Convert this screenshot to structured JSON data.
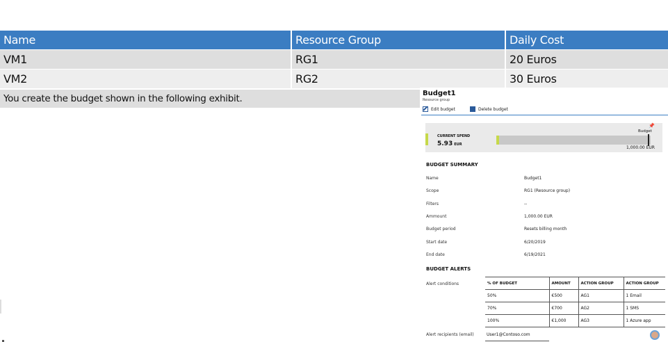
{
  "vm_table": {
    "headers": [
      "Name",
      "Resource Group",
      "Daily Cost"
    ],
    "rows": [
      [
        "VM1",
        "RG1",
        "20 Euros"
      ],
      [
        "VM2",
        "RG2",
        "30 Euros"
      ]
    ]
  },
  "exhibit_text": "You create the budget shown in the following exhibit.",
  "budget_panel": {
    "title": "Budget1",
    "subtitle": "Resource group",
    "toolbar": {
      "edit_label": "Edit budget",
      "delete_label": "Delete budget"
    },
    "current_spend": {
      "label": "CURRENT SPEND",
      "value": "5.93",
      "unit": "EUR",
      "budget_label": "Budget",
      "budget_max": "1,000.00 EUR",
      "fraction_of_budget": 0.00593
    },
    "summary": {
      "heading": "BUDGET SUMMARY",
      "items": [
        {
          "label": "Name",
          "value": "Budget1"
        },
        {
          "label": "Scope",
          "value": "RG1 (Resource group)"
        },
        {
          "label": "Filters",
          "value": "--"
        },
        {
          "label": "Ammount",
          "value": "1,000.00 EUR"
        },
        {
          "label": "Budget period",
          "value": "Resets billing month"
        },
        {
          "label": "Start date",
          "value": "6/20/2019"
        },
        {
          "label": "End date",
          "value": "6/19/2021"
        }
      ]
    },
    "alerts": {
      "heading": "BUDGET ALERTS",
      "conditions_label": "Alert conditions",
      "columns": [
        "% OF BUDGET",
        "AMOUNT",
        "ACTION GROUP",
        "ACTION GROUP"
      ],
      "rows": [
        [
          "50%",
          "€500",
          "AG1",
          "1 Email"
        ],
        [
          "70%",
          "€700",
          "AG2",
          "1 SMS"
        ],
        [
          "100%",
          "€1,000",
          "AG3",
          "1 Azure app"
        ]
      ],
      "recipients_label": "Alert recipients (email)",
      "recipients_value": "User1@Contoso.com"
    }
  },
  "colors": {
    "header_blue": "#3b7dc2",
    "spend_green": "#c6d94a"
  }
}
